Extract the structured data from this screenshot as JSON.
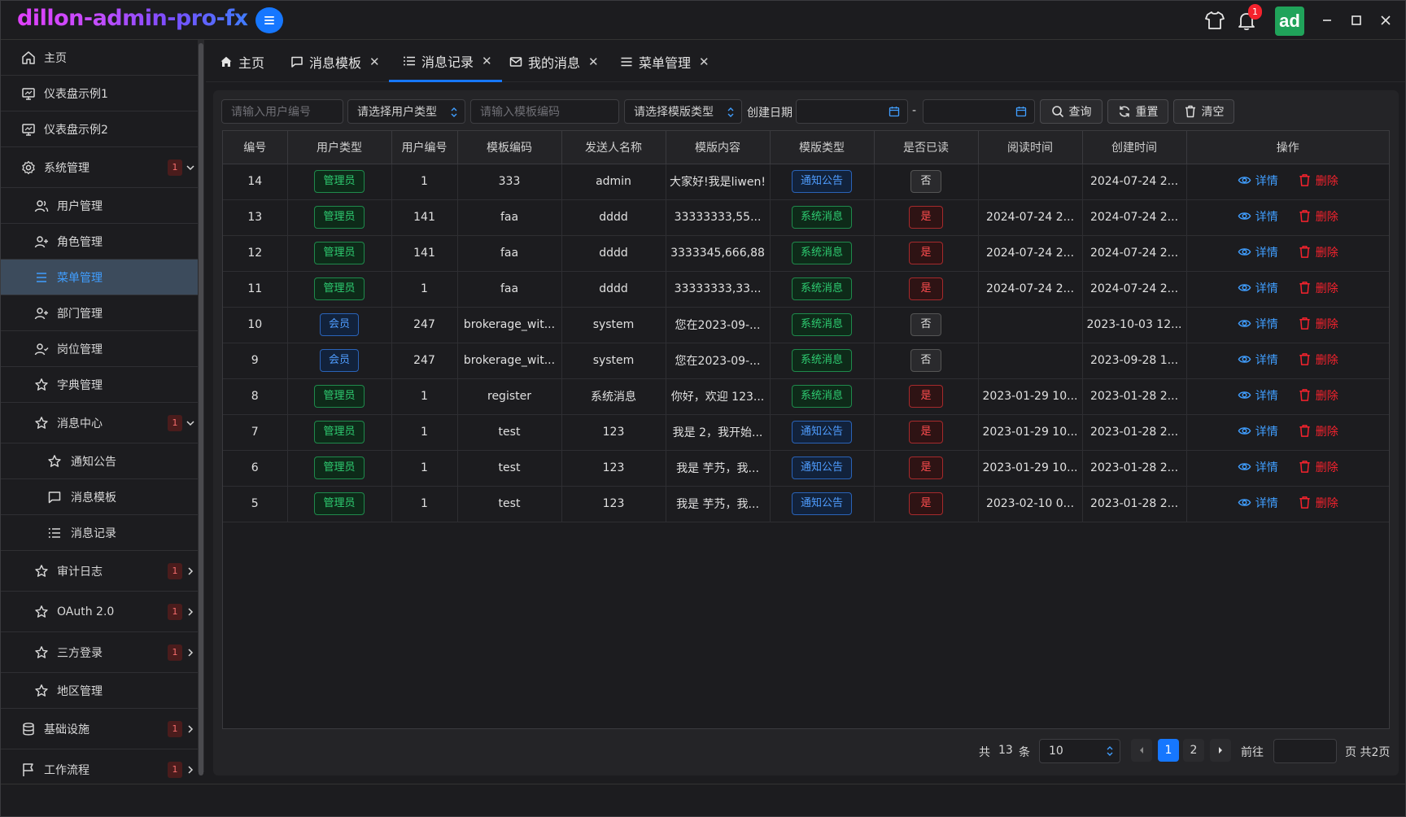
{
  "app": {
    "title": "dillon-admin-pro-fx",
    "notifications_count": "1",
    "avatar_text": "ad"
  },
  "sidebar": {
    "items": [
      {
        "label": "主页"
      },
      {
        "label": "仪表盘示例1"
      },
      {
        "label": "仪表盘示例2"
      },
      {
        "label": "系统管理",
        "badge": "1"
      },
      {
        "label": "用户管理"
      },
      {
        "label": "角色管理"
      },
      {
        "label": "菜单管理"
      },
      {
        "label": "部门管理"
      },
      {
        "label": "岗位管理"
      },
      {
        "label": "字典管理"
      },
      {
        "label": "消息中心",
        "badge": "1"
      },
      {
        "label": "通知公告"
      },
      {
        "label": "消息模板"
      },
      {
        "label": "消息记录"
      },
      {
        "label": "审计日志",
        "badge": "1"
      },
      {
        "label": "OAuth 2.0",
        "badge": "1"
      },
      {
        "label": "三方登录",
        "badge": "1"
      },
      {
        "label": "地区管理"
      },
      {
        "label": "基础设施",
        "badge": "1"
      },
      {
        "label": "工作流程",
        "badge": "1"
      }
    ]
  },
  "tabs": [
    {
      "label": "主页"
    },
    {
      "label": "消息模板"
    },
    {
      "label": "消息记录"
    },
    {
      "label": "我的消息"
    },
    {
      "label": "菜单管理"
    }
  ],
  "filters": {
    "user_id_placeholder": "请输入用户编号",
    "user_type_select": "请选择用户类型",
    "template_code_placeholder": "请输入模板编码",
    "template_type_select": "请选择模版类型",
    "created_date_label": "创建日期",
    "date_separator": "-",
    "query_button": "查询",
    "reset_button": "重置",
    "clear_button": "清空"
  },
  "table": {
    "columns": [
      "编号",
      "用户类型",
      "用户编号",
      "模板编码",
      "发送人名称",
      "模版内容",
      "模版类型",
      "是否已读",
      "阅读时间",
      "创建时间",
      "操作"
    ],
    "detail_label": "详情",
    "delete_label": "删除",
    "rows": [
      {
        "id": "14",
        "user_type": "管理员",
        "user_type_color": "green",
        "user_id": "1",
        "template_code": "333",
        "sender": "admin",
        "content": "大家好!我是liwen!",
        "template_type": "通知公告",
        "type_color": "blue",
        "read": "否",
        "read_color": "gray",
        "read_time": "",
        "created": "2024-07-24 2..."
      },
      {
        "id": "13",
        "user_type": "管理员",
        "user_type_color": "green",
        "user_id": "141",
        "template_code": "faa",
        "sender": "dddd",
        "content": "33333333,55...",
        "template_type": "系统消息",
        "type_color": "green",
        "read": "是",
        "read_color": "red",
        "read_time": "2024-07-24 2...",
        "created": "2024-07-24 2..."
      },
      {
        "id": "12",
        "user_type": "管理员",
        "user_type_color": "green",
        "user_id": "141",
        "template_code": "faa",
        "sender": "dddd",
        "content": "3333345,666,88",
        "template_type": "系统消息",
        "type_color": "green",
        "read": "是",
        "read_color": "red",
        "read_time": "2024-07-24 2...",
        "created": "2024-07-24 2..."
      },
      {
        "id": "11",
        "user_type": "管理员",
        "user_type_color": "green",
        "user_id": "1",
        "template_code": "faa",
        "sender": "dddd",
        "content": "33333333,33...",
        "template_type": "系统消息",
        "type_color": "green",
        "read": "是",
        "read_color": "red",
        "read_time": "2024-07-24 2...",
        "created": "2024-07-24 2..."
      },
      {
        "id": "10",
        "user_type": "会员",
        "user_type_color": "blue",
        "user_id": "247",
        "template_code": "brokerage_wit...",
        "sender": "system",
        "content": "您在2023-09-...",
        "template_type": "系统消息",
        "type_color": "green",
        "read": "否",
        "read_color": "gray",
        "read_time": "",
        "created": "2023-10-03 12..."
      },
      {
        "id": "9",
        "user_type": "会员",
        "user_type_color": "blue",
        "user_id": "247",
        "template_code": "brokerage_wit...",
        "sender": "system",
        "content": "您在2023-09-...",
        "template_type": "系统消息",
        "type_color": "green",
        "read": "否",
        "read_color": "gray",
        "read_time": "",
        "created": "2023-09-28 1..."
      },
      {
        "id": "8",
        "user_type": "管理员",
        "user_type_color": "green",
        "user_id": "1",
        "template_code": "register",
        "sender": "系统消息",
        "content": "你好，欢迎 123...",
        "template_type": "系统消息",
        "type_color": "green",
        "read": "是",
        "read_color": "red",
        "read_time": "2023-01-29 10...",
        "created": "2023-01-28 2..."
      },
      {
        "id": "7",
        "user_type": "管理员",
        "user_type_color": "green",
        "user_id": "1",
        "template_code": "test",
        "sender": "123",
        "content": "我是 2，我开始...",
        "template_type": "通知公告",
        "type_color": "blue",
        "read": "是",
        "read_color": "red",
        "read_time": "2023-01-29 10...",
        "created": "2023-01-28 2..."
      },
      {
        "id": "6",
        "user_type": "管理员",
        "user_type_color": "green",
        "user_id": "1",
        "template_code": "test",
        "sender": "123",
        "content": "我是 芋艿，我...",
        "template_type": "通知公告",
        "type_color": "blue",
        "read": "是",
        "read_color": "red",
        "read_time": "2023-01-29 10...",
        "created": "2023-01-28 2..."
      },
      {
        "id": "5",
        "user_type": "管理员",
        "user_type_color": "green",
        "user_id": "1",
        "template_code": "test",
        "sender": "123",
        "content": "我是 芋艿，我...",
        "template_type": "通知公告",
        "type_color": "blue",
        "read": "是",
        "read_color": "red",
        "read_time": "2023-02-10 0...",
        "created": "2023-01-28 2..."
      }
    ]
  },
  "pagination": {
    "total_prefix": "共",
    "total": "13",
    "total_suffix": "条",
    "page_size": "10",
    "pages": [
      "1",
      "2"
    ],
    "current_page": "1",
    "goto_label": "前往",
    "goto_suffix": "页 共2页"
  }
}
